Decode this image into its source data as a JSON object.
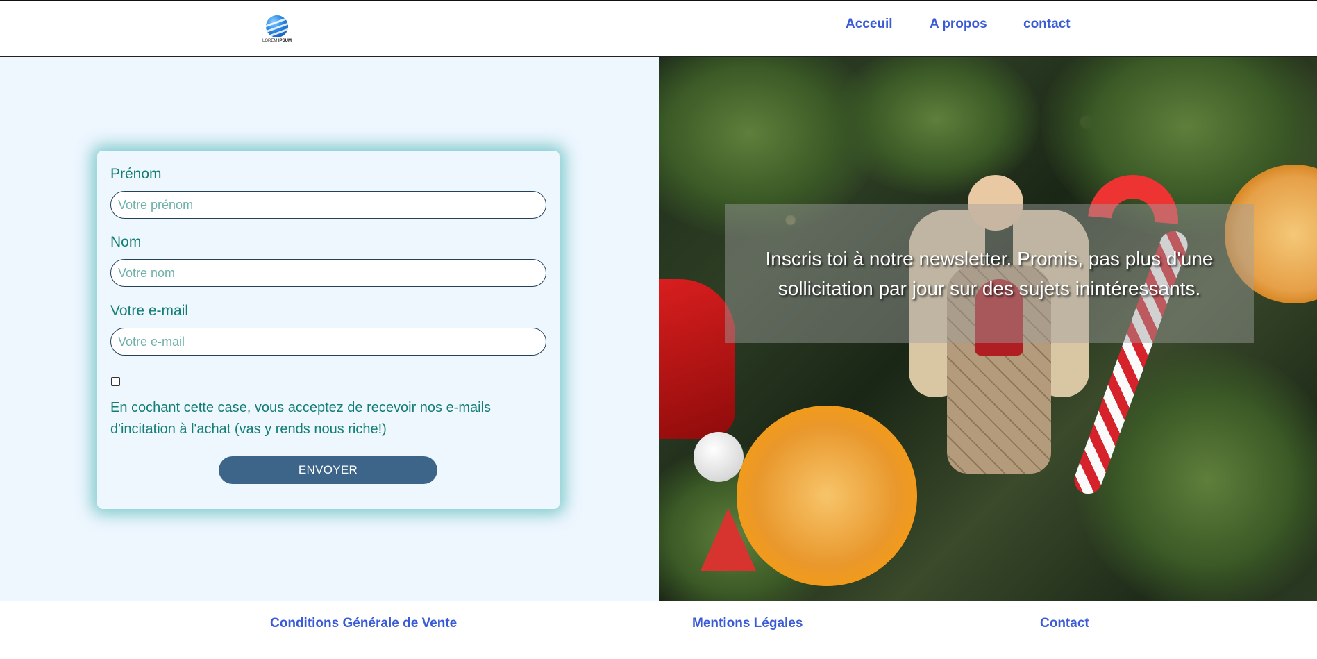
{
  "header": {
    "logo_text_light": "LOREM",
    "logo_text_bold": "IPSUM",
    "nav": [
      "Acceuil",
      "A propos",
      "contact"
    ]
  },
  "form": {
    "prenom_label": "Prénom",
    "prenom_placeholder": "Votre prénom",
    "nom_label": "Nom",
    "nom_placeholder": "Votre nom",
    "email_label": "Votre e-mail",
    "email_placeholder": "Votre e-mail",
    "consent_checked": false,
    "consent_text": "En cochant cette case, vous acceptez de recevoir nos e-mails d'incitation à l'achat (vas y rends nous riche!)",
    "submit_label": "ENVOYER"
  },
  "hero": {
    "text": "Inscris toi à notre newsletter. Promis, pas plus d'une sollicitation par jour sur des sujets inintéressants."
  },
  "footer": {
    "links": [
      "Conditions Générale de Vente",
      "Mentions Légales",
      "Contact"
    ]
  },
  "colors": {
    "nav_link": "#3a5bd6",
    "form_text": "#137e75",
    "button_bg": "#3c6589",
    "page_bg": "#eef6fe"
  }
}
